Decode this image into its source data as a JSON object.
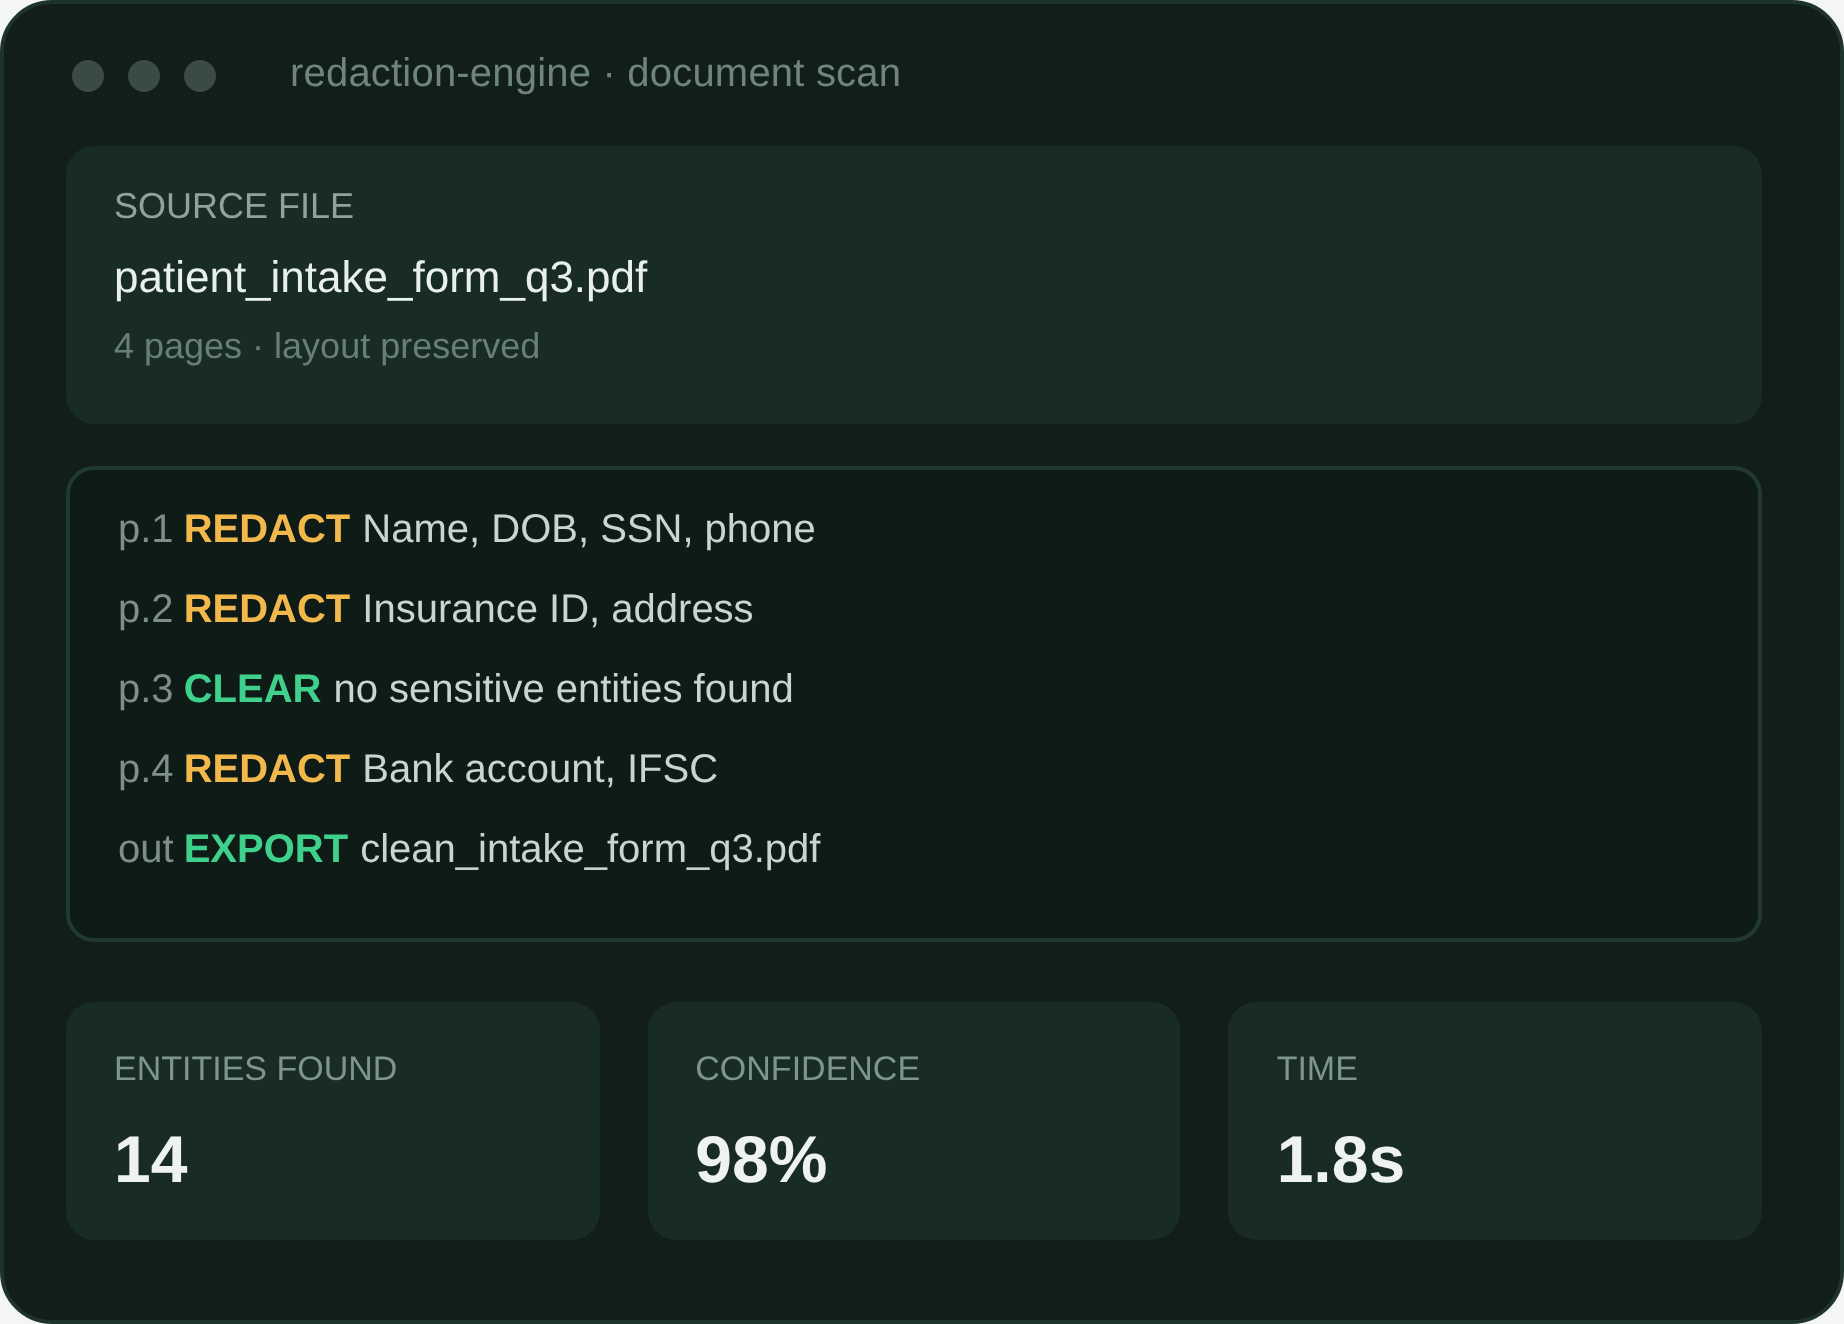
{
  "window": {
    "title": "redaction-engine · document scan"
  },
  "source": {
    "label": "SOURCE FILE",
    "filename": "patient_intake_form_q3.pdf",
    "details": "4 pages · layout preserved"
  },
  "log": [
    {
      "prefix": "p.1",
      "action": "REDACT",
      "detail": "Name, DOB, SSN, phone",
      "color": "#f2b84b"
    },
    {
      "prefix": "p.2",
      "action": "REDACT",
      "detail": "Insurance ID, address",
      "color": "#f2b84b"
    },
    {
      "prefix": "p.3",
      "action": "CLEAR",
      "detail": "no sensitive entities found",
      "color": "#3fd18c"
    },
    {
      "prefix": "p.4",
      "action": "REDACT",
      "detail": "Bank account, IFSC",
      "color": "#f2b84b"
    },
    {
      "prefix": "out",
      "action": "EXPORT",
      "detail": "clean_intake_form_q3.pdf",
      "color": "#3fd18c"
    }
  ],
  "stats": [
    {
      "label": "ENTITIES FOUND",
      "value": "14"
    },
    {
      "label": "CONFIDENCE",
      "value": "98%"
    },
    {
      "label": "TIME",
      "value": "1.8s"
    }
  ]
}
